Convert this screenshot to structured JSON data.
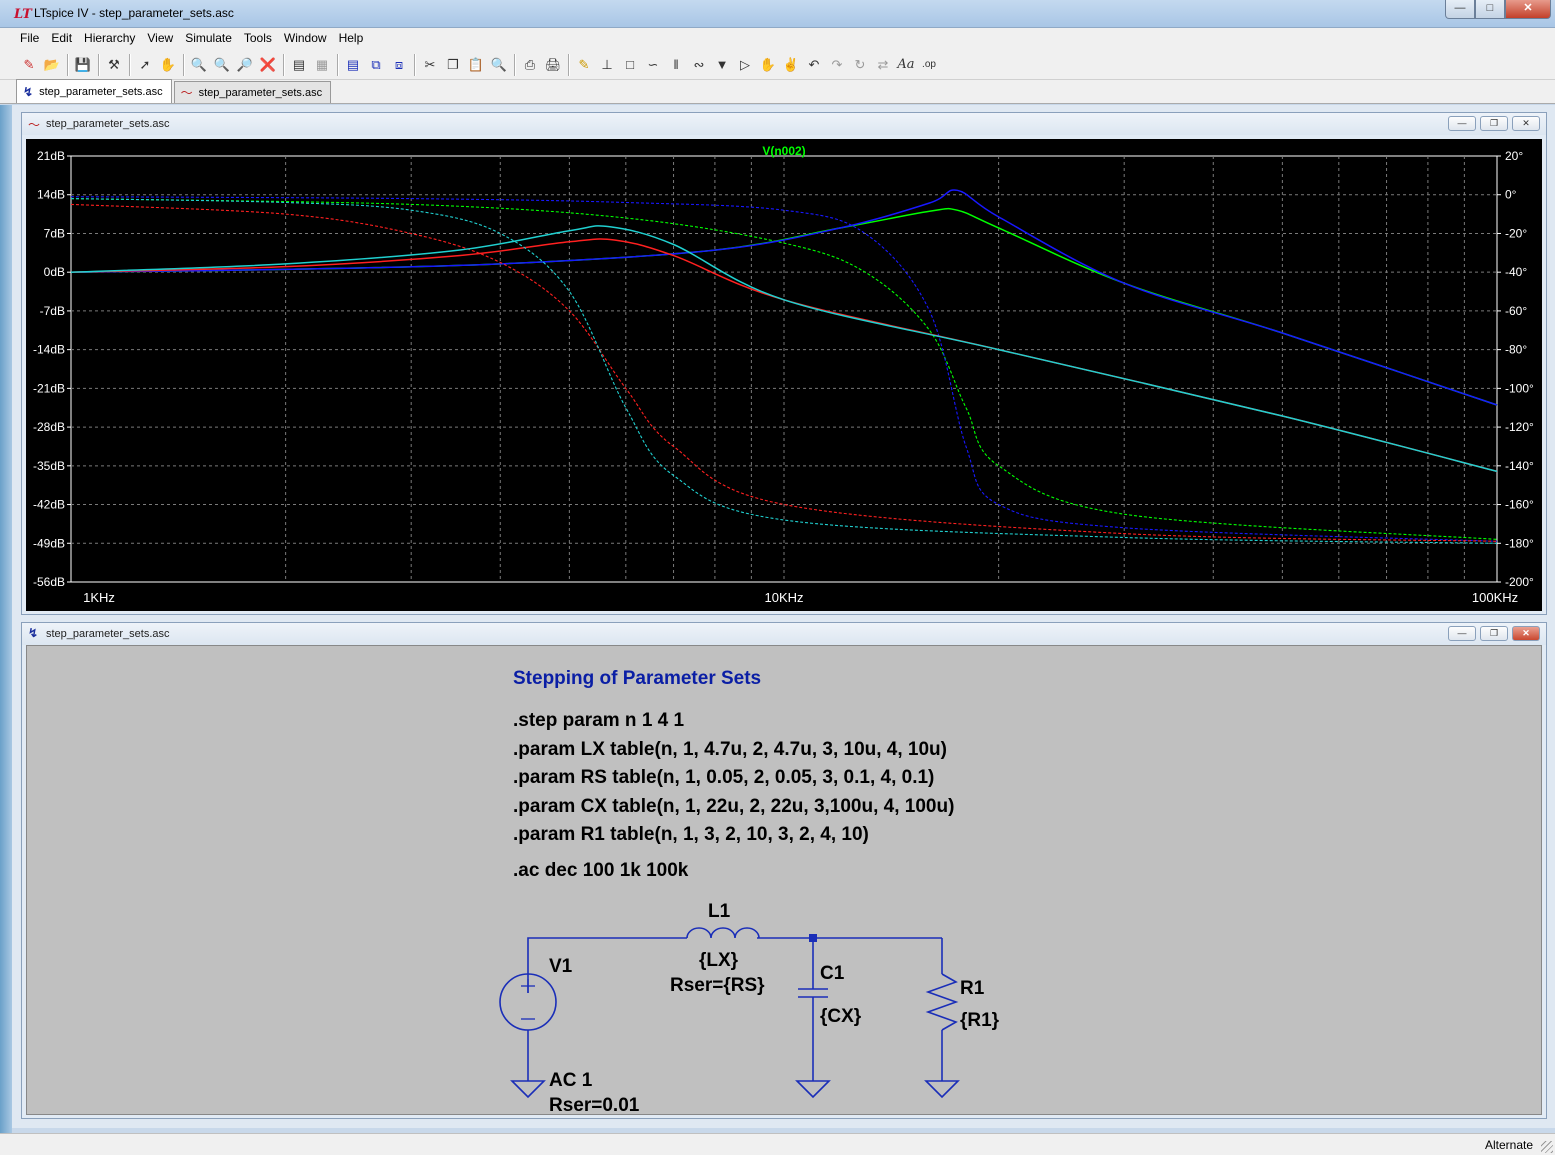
{
  "window": {
    "title": "LTspice IV - step_parameter_sets.asc"
  },
  "menu": [
    "File",
    "Edit",
    "Hierarchy",
    "View",
    "Simulate",
    "Tools",
    "Window",
    "Help"
  ],
  "tabs": [
    {
      "label": "step_parameter_sets.asc",
      "type": "schematic",
      "active": true
    },
    {
      "label": "step_parameter_sets.asc",
      "type": "waveform",
      "active": false
    }
  ],
  "waveform_window": {
    "title": "step_parameter_sets.asc"
  },
  "schematic_window": {
    "title": "step_parameter_sets.asc"
  },
  "plot": {
    "trace_label": "V(n002)",
    "left_ticks": [
      "21dB",
      "14dB",
      "7dB",
      "0dB",
      "-7dB",
      "-14dB",
      "-21dB",
      "-28dB",
      "-35dB",
      "-42dB",
      "-49dB",
      "-56dB"
    ],
    "right_ticks": [
      "20°",
      "0°",
      "-20°",
      "-40°",
      "-60°",
      "-80°",
      "-100°",
      "-120°",
      "-140°",
      "-160°",
      "-180°",
      "-200°"
    ],
    "x_ticks": [
      "1KHz",
      "10KHz",
      "100KHz"
    ]
  },
  "chart_data": {
    "type": "line",
    "x_scale": "log",
    "xlim": [
      1000,
      100000
    ],
    "ylim": [
      -56,
      21
    ],
    "y2lim": [
      -200,
      20
    ],
    "ylabel_unit": "dB",
    "y2label_unit": "°",
    "grid": true,
    "series": [
      {
        "name": "V(n002)",
        "step": "1",
        "color": "#00ff00",
        "magnitude": [
          [
            1000,
            0
          ],
          [
            2000,
            0.5
          ],
          [
            4000,
            1.5
          ],
          [
            8000,
            4
          ],
          [
            12000,
            8
          ],
          [
            16000,
            11
          ],
          [
            17500,
            11.2
          ],
          [
            20000,
            8
          ],
          [
            30000,
            -2
          ],
          [
            50000,
            -11
          ],
          [
            100000,
            -24
          ]
        ],
        "phase": [
          [
            1000,
            -2
          ],
          [
            3000,
            -5
          ],
          [
            6000,
            -12
          ],
          [
            10000,
            -25
          ],
          [
            13000,
            -40
          ],
          [
            16000,
            -70
          ],
          [
            18000,
            -110
          ],
          [
            20000,
            -140
          ],
          [
            30000,
            -165
          ],
          [
            100000,
            -178
          ]
        ]
      },
      {
        "name": "V(n002)",
        "step": "2",
        "color": "#1818ff",
        "magnitude": [
          [
            1000,
            0
          ],
          [
            2000,
            0.5
          ],
          [
            4000,
            1.5
          ],
          [
            8000,
            4
          ],
          [
            12000,
            8
          ],
          [
            16000,
            12.5
          ],
          [
            17500,
            14.8
          ],
          [
            20000,
            10
          ],
          [
            30000,
            -2
          ],
          [
            50000,
            -11
          ],
          [
            100000,
            -24
          ]
        ],
        "phase": [
          [
            1000,
            -1
          ],
          [
            3000,
            -2
          ],
          [
            6000,
            -4
          ],
          [
            10000,
            -8
          ],
          [
            13000,
            -20
          ],
          [
            16000,
            -60
          ],
          [
            18000,
            -130
          ],
          [
            20000,
            -160
          ],
          [
            30000,
            -172
          ],
          [
            100000,
            -179
          ]
        ]
      },
      {
        "name": "V(n002)",
        "step": "3",
        "color": "#ff2020",
        "magnitude": [
          [
            1000,
            0
          ],
          [
            2000,
            1
          ],
          [
            3500,
            3
          ],
          [
            5000,
            5.5
          ],
          [
            5800,
            5.8
          ],
          [
            7000,
            3
          ],
          [
            10000,
            -5
          ],
          [
            20000,
            -14
          ],
          [
            50000,
            -26
          ],
          [
            100000,
            -36
          ]
        ],
        "phase": [
          [
            1000,
            -5
          ],
          [
            2000,
            -10
          ],
          [
            3000,
            -20
          ],
          [
            4000,
            -35
          ],
          [
            5000,
            -60
          ],
          [
            6000,
            -100
          ],
          [
            7000,
            -130
          ],
          [
            10000,
            -160
          ],
          [
            30000,
            -175
          ],
          [
            100000,
            -179
          ]
        ]
      },
      {
        "name": "V(n002)",
        "step": "4",
        "color": "#20d0d0",
        "magnitude": [
          [
            1000,
            0
          ],
          [
            2000,
            1.5
          ],
          [
            3500,
            4
          ],
          [
            5000,
            7.5
          ],
          [
            5700,
            8.2
          ],
          [
            7000,
            5
          ],
          [
            10000,
            -5
          ],
          [
            20000,
            -14
          ],
          [
            50000,
            -26
          ],
          [
            100000,
            -36
          ]
        ],
        "phase": [
          [
            1000,
            -2
          ],
          [
            2000,
            -4
          ],
          [
            3000,
            -8
          ],
          [
            4000,
            -20
          ],
          [
            5000,
            -50
          ],
          [
            6000,
            -110
          ],
          [
            7000,
            -145
          ],
          [
            10000,
            -168
          ],
          [
            30000,
            -177
          ],
          [
            100000,
            -180
          ]
        ]
      }
    ]
  },
  "schematic": {
    "title": "Stepping of Parameter Sets",
    "directives": [
      ".step param n 1 4 1",
      ".param LX table(n, 1, 4.7u, 2, 4.7u, 3, 10u, 4, 10u)",
      ".param RS table(n, 1, 0.05, 2, 0.05, 3, 0.1, 4, 0.1)",
      ".param CX table(n, 1, 22u, 2, 22u, 3,100u, 4, 100u)",
      ".param R1 table(n, 1, 3, 2, 10, 3, 2, 4, 10)"
    ],
    "ac": ".ac dec 100 1k 100k",
    "components": {
      "v1": {
        "name": "V1",
        "value": "AC 1",
        "extra": "Rser=0.01"
      },
      "l1": {
        "name": "L1",
        "value": "{LX}",
        "extra": "Rser={RS}"
      },
      "c1": {
        "name": "C1",
        "value": "{CX}"
      },
      "r1": {
        "name": "R1",
        "value": "{R1}"
      }
    }
  },
  "status": {
    "mode": "Alternate"
  },
  "colors": {
    "wire": "#1a2eb8",
    "grid": "#7a7a7a",
    "bg_plot": "#000000",
    "bg_schematic": "#c0c0c0"
  }
}
